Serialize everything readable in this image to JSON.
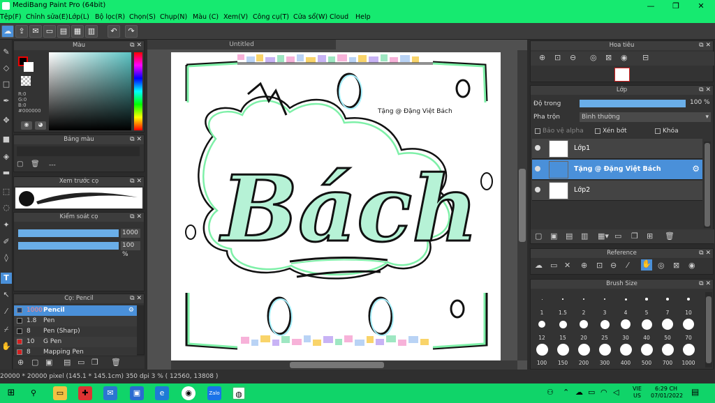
{
  "window": {
    "title": "MediBang Paint Pro (64bit)",
    "minimize": "—",
    "maximize": "❐",
    "close": "✕"
  },
  "menu": [
    "Tệp(F)",
    "Chỉnh sửa(E)",
    "Lớp(L)",
    "Bộ lọc(R)",
    "Chọn(S)",
    "Chụp(N)",
    "Màu (C)",
    "Xem(V)",
    "Công cụ(T)",
    "Cửa sổ(W)",
    "Cloud",
    "Help"
  ],
  "panels": {
    "color": {
      "title": "Màu",
      "rgb": [
        "R:0",
        "G:0",
        "B:0"
      ],
      "hex": "#000000"
    },
    "palette": {
      "title": "Bảng màu",
      "value": "---"
    },
    "brush_preview": {
      "title": "Xem trước cọ"
    },
    "brush_control": {
      "title": "Kiểm soát cọ",
      "size": "1000",
      "opacity": "100 %"
    },
    "brush": {
      "title": "Cọ: Pencil",
      "items": [
        {
          "size": "1000",
          "name": "Pencil",
          "color": "#1a3b6e"
        },
        {
          "size": "1.8",
          "name": "Pen",
          "color": "#1a1a1a"
        },
        {
          "size": "8",
          "name": "Pen (Sharp)",
          "color": "#1a1a1a"
        },
        {
          "size": "10",
          "name": "G Pen",
          "color": "#d42020"
        },
        {
          "size": "8",
          "name": "Mapping Pen",
          "color": "#d42020"
        }
      ]
    },
    "navigator": {
      "title": "Hoa tiêu"
    },
    "layer": {
      "title": "Lớp",
      "opacity_label": "Độ trong",
      "opacity_value": "100 %",
      "blend_label": "Pha trộn",
      "blend_value": "Bình thường",
      "protect_alpha": "Bảo vệ alpha",
      "clipping": "Xén bớt",
      "lock": "Khóa",
      "layers": [
        {
          "name": "Lớp1",
          "selected": false
        },
        {
          "name": "Tặng @ Đặng Việt Bách",
          "selected": true
        },
        {
          "name": "Lớp2",
          "selected": false
        }
      ]
    },
    "reference": {
      "title": "Reference"
    },
    "brush_size": {
      "title": "Brush Size",
      "sizes": [
        "1",
        "1.5",
        "2",
        "3",
        "4",
        "5",
        "7",
        "10",
        "12",
        "15",
        "20",
        "25",
        "30",
        "40",
        "50",
        "70",
        "100",
        "150",
        "200",
        "300",
        "400",
        "500",
        "700",
        "1000"
      ]
    }
  },
  "canvas": {
    "tab": "Untitled",
    "credit": "Tặng @ Đặng Việt Bách",
    "art_text": "Bách"
  },
  "status": "20000 * 20000 pixel  (145.1 * 145.1cm)  350 dpi  3 %  ( 12560, 13808 )",
  "taskbar": {
    "lang1": "VIE",
    "lang2": "US",
    "time": "6:29 CH",
    "date": "07/01/2022"
  },
  "colors": {
    "titlebar": "#16ea70",
    "accent": "#4a90d9",
    "selected": "#4a90d9"
  }
}
